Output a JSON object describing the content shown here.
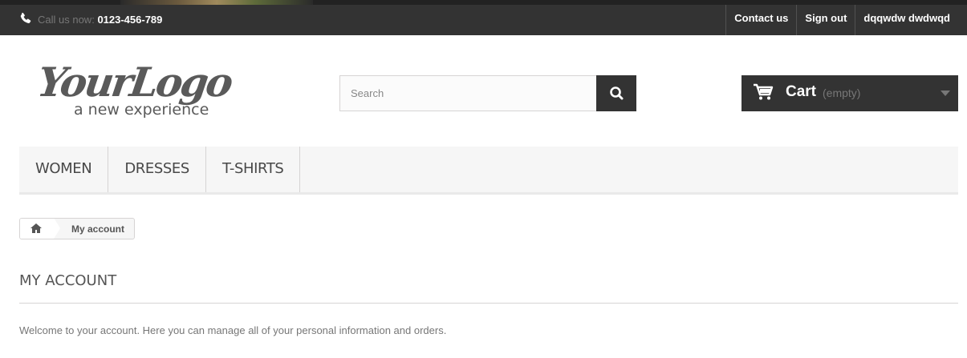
{
  "topbar": {
    "call_prefix": "Call us now:",
    "phone": "0123-456-789",
    "links": [
      "Contact us",
      "Sign out",
      "dqqwdw dwdwqd"
    ]
  },
  "logo": {
    "name": "YourLogo",
    "tagline": "a new experience"
  },
  "search": {
    "placeholder": "Search",
    "button_icon": "search-icon"
  },
  "cart": {
    "label": "Cart",
    "status": "(empty)"
  },
  "menu": {
    "items": [
      "WOMEN",
      "DRESSES",
      "T-SHIRTS"
    ]
  },
  "breadcrumb": {
    "home_icon": "home-icon",
    "current": "My account"
  },
  "page": {
    "heading": "MY ACCOUNT",
    "info": "Welcome to your account. Here you can manage all of your personal information and orders."
  },
  "colors": {
    "dark_bar": "#333333",
    "menu_bg": "#f6f6f6",
    "border": "#d6d4d4"
  }
}
